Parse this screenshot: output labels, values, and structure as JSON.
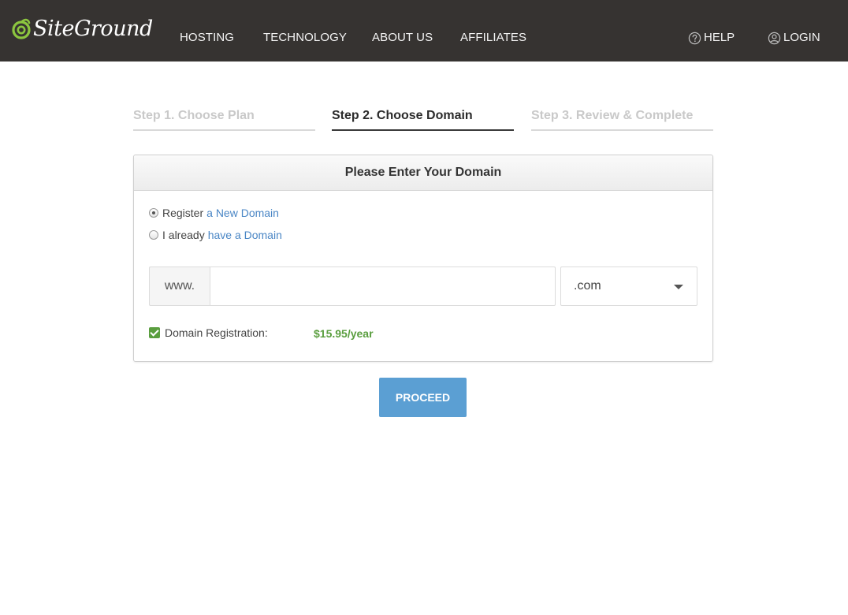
{
  "header": {
    "logo_text": "SiteGround",
    "nav": [
      {
        "label": "HOSTING"
      },
      {
        "label": "TECHNOLOGY"
      },
      {
        "label": "ABOUT US"
      },
      {
        "label": "AFFILIATES"
      }
    ],
    "help_label": "HELP",
    "login_label": "LOGIN",
    "help_icon": "question-circle-icon",
    "login_icon": "user-circle-icon"
  },
  "steps": [
    {
      "label": "Step 1. Choose Plan",
      "state": "inactive"
    },
    {
      "label": "Step 2. Choose Domain",
      "state": "active"
    },
    {
      "label": "Step 3. Review & Complete",
      "state": "inactive"
    }
  ],
  "card": {
    "title": "Please Enter Your Domain",
    "options": [
      {
        "prefix": "Register",
        "link": "a New Domain",
        "selected": true
      },
      {
        "prefix": "I already",
        "link": "have a Domain",
        "selected": false
      }
    ],
    "www_prefix": "www.",
    "domain_value": "",
    "domain_placeholder": "",
    "tld_selected": ".com",
    "registration_label": "Domain Registration:",
    "registration_checked": true,
    "registration_price": "$15.95/year"
  },
  "actions": {
    "proceed_label": "PROCEED"
  },
  "colors": {
    "topbar": "#363331",
    "accent_blue": "#5b9fd3",
    "link_blue": "#4a86c5",
    "price_green": "#5a9e3f"
  }
}
